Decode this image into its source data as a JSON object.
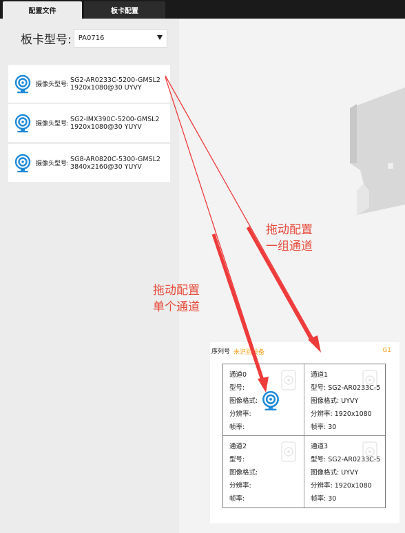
{
  "tabs": [
    {
      "label": "配置文件",
      "active": true
    },
    {
      "label": "板卡配置",
      "active": false
    }
  ],
  "board": {
    "label": "板卡型号:",
    "value": "PA0716"
  },
  "camera_list": {
    "item_label": "摄像头型号:",
    "items": [
      {
        "model": "SG2-AR0233C-5200-GMSL2",
        "format": "1920x1080@30 UYVY"
      },
      {
        "model": "SG2-IMX390C-5200-GMSL2",
        "format": "1920x1080@30 YUYV"
      },
      {
        "model": "SG8-AR0820C-5300-GMSL2",
        "format": "3840x2160@30 YUYV"
      }
    ]
  },
  "hints": {
    "group_line1": "拖动配置",
    "group_line2": "一组通道",
    "single_line1": "拖动配置",
    "single_line2": "单个通道"
  },
  "board_panel": {
    "serial_label": "序列号",
    "serial_value": "未识别设备",
    "group": "G1",
    "channels": [
      {
        "name": "通道0",
        "model_label": "型号:",
        "model": "",
        "format_label": "图像格式:",
        "format": "",
        "res_label": "分辨率:",
        "res": "",
        "fps_label": "帧率:",
        "fps": ""
      },
      {
        "name": "通道1",
        "model_label": "型号:",
        "model": "SG2-AR0233C-5",
        "format_label": "图像格式:",
        "format": "UYVY",
        "res_label": "分辨率:",
        "res": "1920x1080",
        "fps_label": "帧率:",
        "fps": "30"
      },
      {
        "name": "通道2",
        "model_label": "型号:",
        "model": "",
        "format_label": "图像格式:",
        "format": "",
        "res_label": "分辨率:",
        "res": "",
        "fps_label": "帧率:",
        "fps": ""
      },
      {
        "name": "通道3",
        "model_label": "型号:",
        "model": "SG2-AR0233C-5",
        "format_label": "图像格式:",
        "format": "UYVY",
        "res_label": "分辨率:",
        "res": "1920x1080",
        "fps_label": "帧率:",
        "fps": "30"
      }
    ]
  },
  "colors": {
    "accent": "#1f8ad8",
    "hint": "#e74c3c",
    "warning": "#f5a623",
    "tabbar": "#1a1a1a"
  },
  "icons": {
    "camera": "webcam-icon",
    "dropdown": "chevron-down-icon"
  }
}
